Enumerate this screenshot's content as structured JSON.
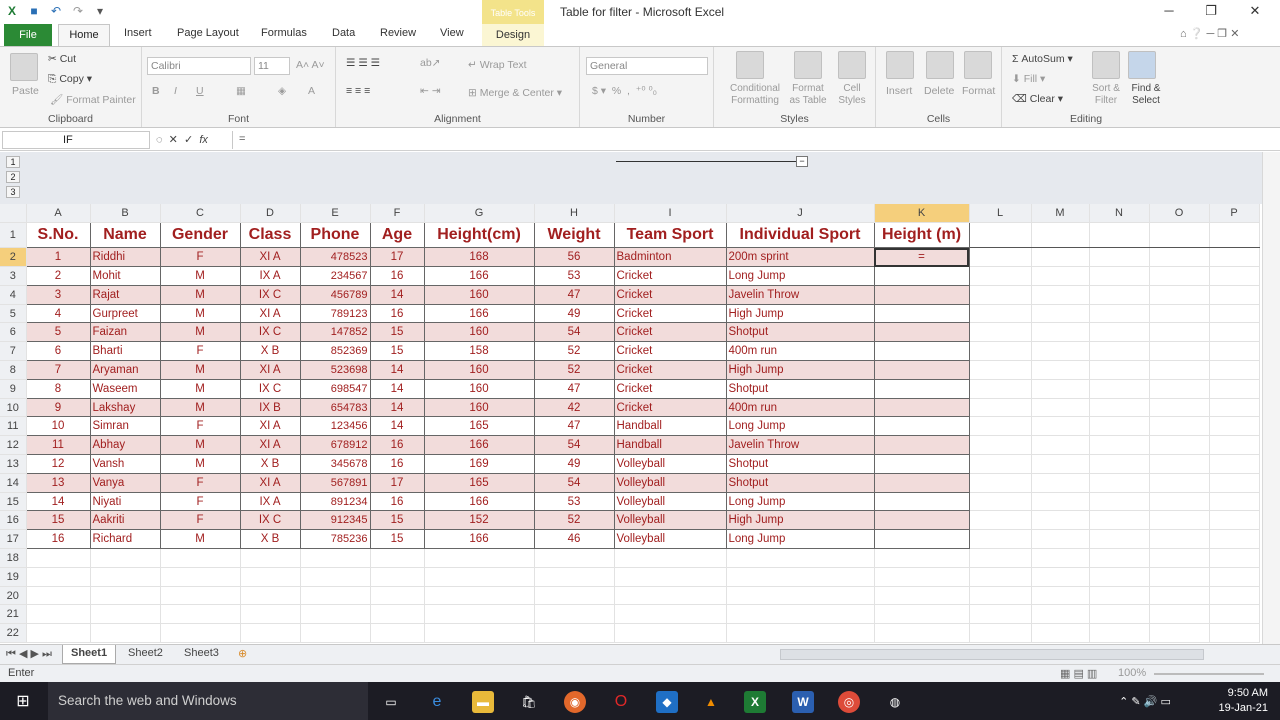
{
  "window": {
    "title": "Table for filter - Microsoft Excel",
    "table_tools": "Table Tools"
  },
  "ribbon_tabs": [
    "File",
    "Home",
    "Insert",
    "Page Layout",
    "Formulas",
    "Data",
    "Review",
    "View",
    "Design"
  ],
  "ribbon": {
    "clipboard": {
      "label": "Clipboard",
      "paste": "Paste",
      "cut": "Cut",
      "copy": "Copy",
      "format_painter": "Format Painter"
    },
    "font": {
      "label": "Font",
      "font_name": "Calibri",
      "font_size": "11"
    },
    "alignment": {
      "label": "Alignment",
      "wrap_text": "Wrap Text",
      "merge_center": "Merge & Center"
    },
    "number": {
      "label": "Number",
      "format": "General"
    },
    "styles": {
      "label": "Styles",
      "conditional": "Conditional Formatting",
      "format_table": "Format as Table",
      "cell_styles": "Cell Styles"
    },
    "cells": {
      "label": "Cells",
      "insert": "Insert",
      "delete": "Delete",
      "format": "Format"
    },
    "editing": {
      "label": "Editing",
      "autosum": "AutoSum",
      "fill": "Fill",
      "clear": "Clear",
      "sort_filter": "Sort & Filter",
      "find_select": "Find & Select"
    }
  },
  "formula_bar": {
    "name_box": "IF",
    "formula": "="
  },
  "outline_levels": [
    "1",
    "2",
    "3"
  ],
  "columns": [
    "A",
    "B",
    "C",
    "D",
    "E",
    "F",
    "G",
    "H",
    "I",
    "J",
    "K",
    "L",
    "M",
    "N",
    "O",
    "P"
  ],
  "headers": [
    "S.No.",
    "Name",
    "Gender",
    "Class",
    "Phone",
    "Age",
    "Height(cm)",
    "Weight",
    "Team Sport",
    "Individual Sport",
    "Height (m)"
  ],
  "rows": [
    [
      "1",
      "Riddhi",
      "F",
      "XI A",
      "478523",
      "17",
      "168",
      "56",
      "Badminton",
      "200m sprint",
      "="
    ],
    [
      "2",
      "Mohit",
      "M",
      "IX A",
      "234567",
      "16",
      "166",
      "53",
      "Cricket",
      "Long Jump",
      ""
    ],
    [
      "3",
      "Rajat",
      "M",
      "IX C",
      "456789",
      "14",
      "160",
      "47",
      "Cricket",
      "Javelin Throw",
      ""
    ],
    [
      "4",
      "Gurpreet",
      "M",
      "XI A",
      "789123",
      "16",
      "166",
      "49",
      "Cricket",
      "High Jump",
      ""
    ],
    [
      "5",
      "Faizan",
      "M",
      "IX C",
      "147852",
      "15",
      "160",
      "54",
      "Cricket",
      "Shotput",
      ""
    ],
    [
      "6",
      "Bharti",
      "F",
      "X B",
      "852369",
      "15",
      "158",
      "52",
      "Cricket",
      "400m run",
      ""
    ],
    [
      "7",
      "Aryaman",
      "M",
      "XI A",
      "523698",
      "14",
      "160",
      "52",
      "Cricket",
      "High Jump",
      ""
    ],
    [
      "8",
      "Waseem",
      "M",
      "IX C",
      "698547",
      "14",
      "160",
      "47",
      "Cricket",
      "Shotput",
      ""
    ],
    [
      "9",
      "Lakshay",
      "M",
      "IX B",
      "654783",
      "14",
      "160",
      "42",
      "Cricket",
      "400m run",
      ""
    ],
    [
      "10",
      "Simran",
      "F",
      "XI A",
      "123456",
      "14",
      "165",
      "47",
      "Handball",
      "Long Jump",
      ""
    ],
    [
      "11",
      "Abhay",
      "M",
      "XI A",
      "678912",
      "16",
      "166",
      "54",
      "Handball",
      "Javelin Throw",
      ""
    ],
    [
      "12",
      "Vansh",
      "M",
      "X B",
      "345678",
      "16",
      "169",
      "49",
      "Volleyball",
      "Shotput",
      ""
    ],
    [
      "13",
      "Vanya",
      "F",
      "XI A",
      "567891",
      "17",
      "165",
      "54",
      "Volleyball",
      "Shotput",
      ""
    ],
    [
      "14",
      "Niyati",
      "F",
      "IX A",
      "891234",
      "16",
      "166",
      "53",
      "Volleyball",
      "Long Jump",
      ""
    ],
    [
      "15",
      "Aakriti",
      "F",
      "IX C",
      "912345",
      "15",
      "152",
      "52",
      "Volleyball",
      "High Jump",
      ""
    ],
    [
      "16",
      "Richard",
      "M",
      "X B",
      "785236",
      "15",
      "166",
      "46",
      "Volleyball",
      "Long Jump",
      ""
    ]
  ],
  "row_numbers": [
    "1",
    "2",
    "3",
    "4",
    "5",
    "6",
    "7",
    "8",
    "9",
    "10",
    "11",
    "12",
    "13",
    "14",
    "15",
    "16",
    "17",
    "18",
    "19",
    "20",
    "21",
    "22"
  ],
  "sheets": [
    "Sheet1",
    "Sheet2",
    "Sheet3"
  ],
  "status": {
    "mode": "Enter",
    "zoom": "100%"
  },
  "taskbar": {
    "search_placeholder": "Search the web and Windows",
    "time": "9:50 AM",
    "date": "19-Jan-21"
  },
  "colors": {
    "accent_file": "#2b8a35",
    "table_band": "#f2dcdb",
    "table_text": "#a11f1f",
    "selected_header": "#f5cf7c"
  }
}
